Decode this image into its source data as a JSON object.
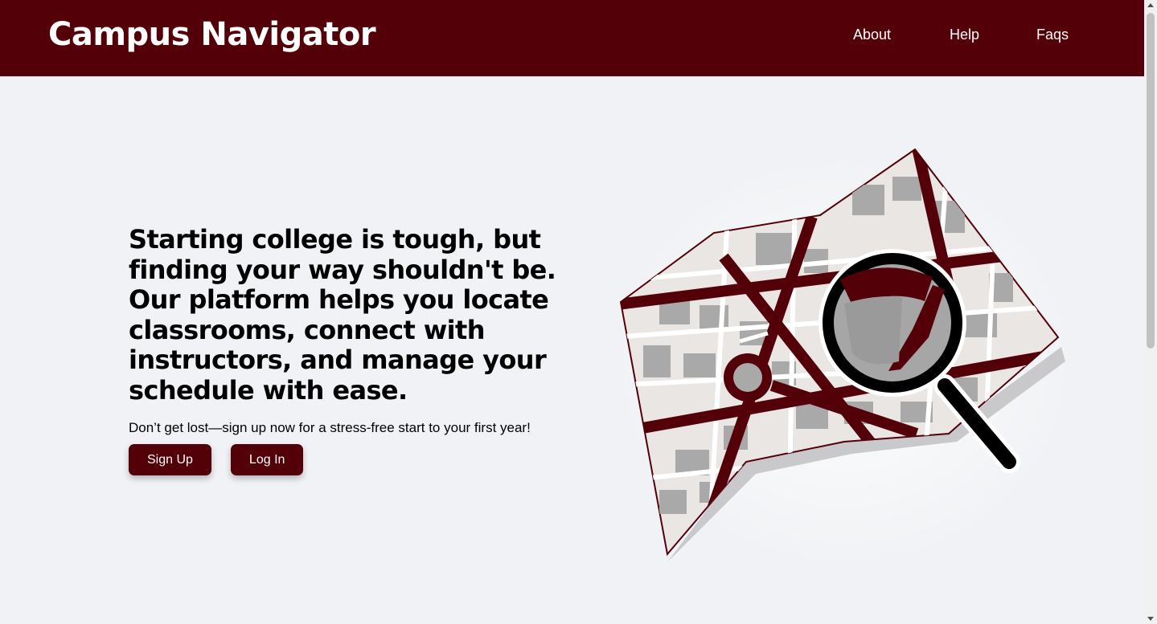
{
  "header": {
    "brand": "Campus Navigator",
    "nav": [
      "About",
      "Help",
      "Faqs"
    ]
  },
  "hero": {
    "headline": "Starting college is tough, but finding your way shouldn't be. Our platform helps you locate classrooms, connect with instructors, and manage your schedule with ease.",
    "subline": "Don’t get lost—sign up now for a stress-free start to your first year!",
    "buttons": {
      "signup": "Sign Up",
      "login": "Log In"
    }
  },
  "colors": {
    "brand": "#530008",
    "page_background": "#f0f2f5"
  },
  "icons": {
    "illustration": "map-with-magnifying-glass"
  }
}
